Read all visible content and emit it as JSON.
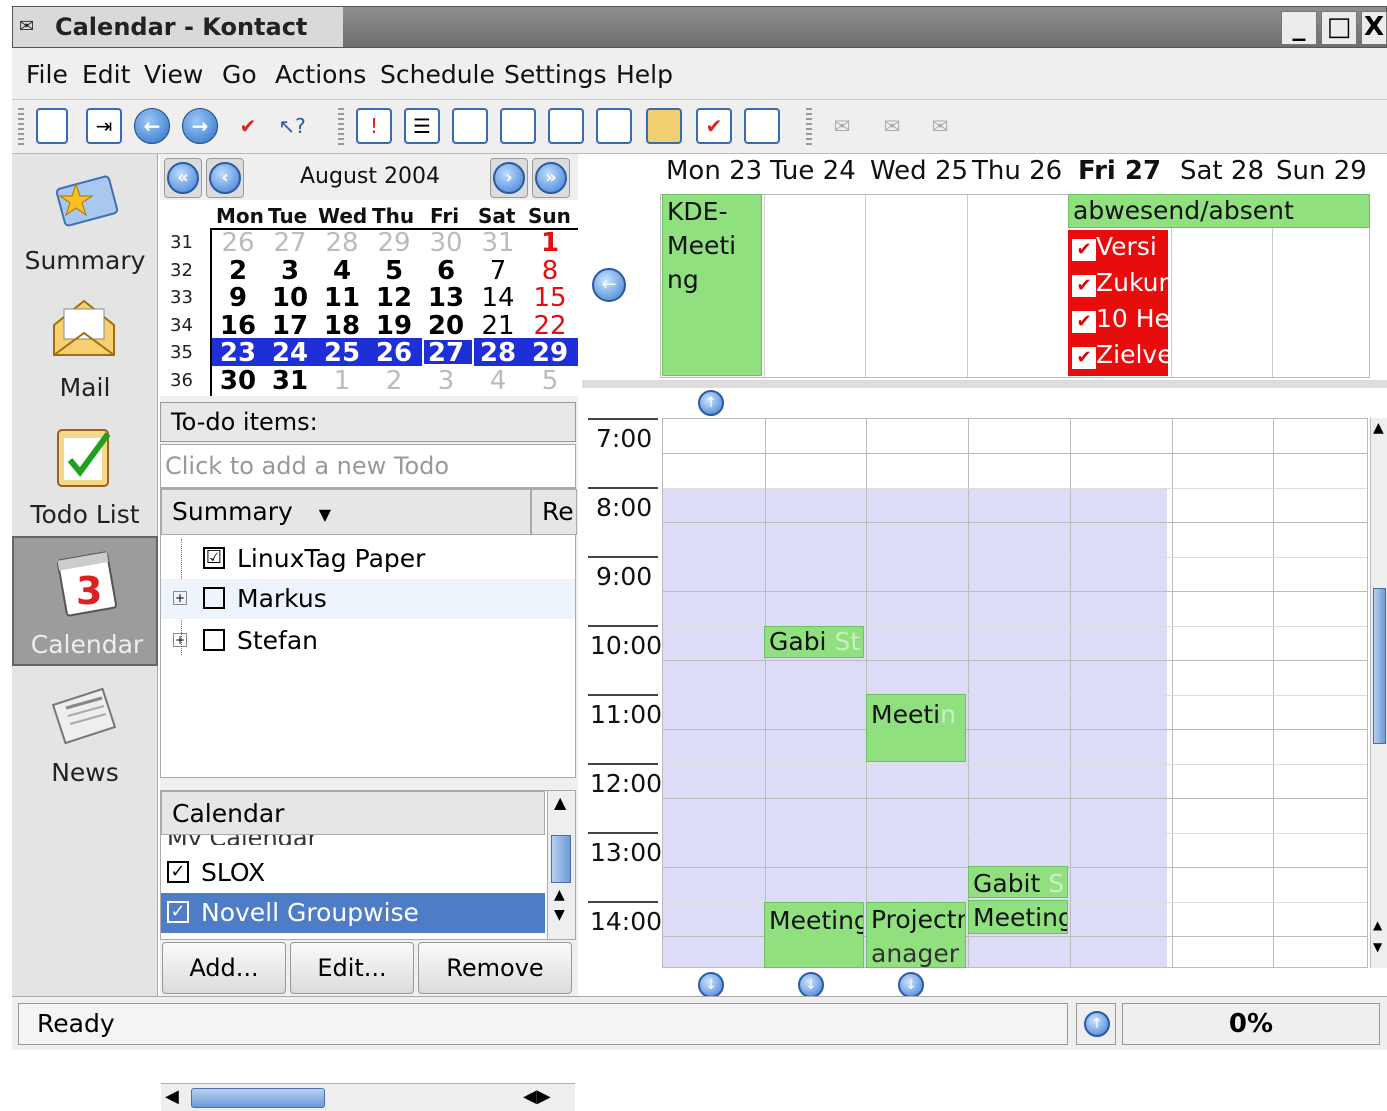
{
  "window": {
    "title": "Calendar - Kontact",
    "min": "_",
    "max": "□",
    "close": "X"
  },
  "menu": [
    "File",
    "Edit",
    "View",
    "Go",
    "Actions",
    "Schedule",
    "Settings",
    "Help"
  ],
  "sidebar": [
    {
      "label": "Summary",
      "icon": "summary-icon"
    },
    {
      "label": "Mail",
      "icon": "mail-icon"
    },
    {
      "label": "Todo List",
      "icon": "todo-icon"
    },
    {
      "label": "Calendar",
      "icon": "calendar-icon",
      "calendar_day": "3"
    },
    {
      "label": "News",
      "icon": "news-icon"
    }
  ],
  "datenav": {
    "month": "August 2004",
    "day_headers": [
      "Mon",
      "Tue",
      "Wed",
      "Thu",
      "Fri",
      "Sat",
      "Sun"
    ],
    "weeks": [
      {
        "no": "31",
        "days": [
          "26",
          "27",
          "28",
          "29",
          "30",
          "31",
          "1"
        ]
      },
      {
        "no": "32",
        "days": [
          "2",
          "3",
          "4",
          "5",
          "6",
          "7",
          "8"
        ]
      },
      {
        "no": "33",
        "days": [
          "9",
          "10",
          "11",
          "12",
          "13",
          "14",
          "15"
        ]
      },
      {
        "no": "34",
        "days": [
          "16",
          "17",
          "18",
          "19",
          "20",
          "21",
          "22"
        ]
      },
      {
        "no": "35",
        "days": [
          "23",
          "24",
          "25",
          "26",
          "27",
          "28",
          "29"
        ]
      },
      {
        "no": "36",
        "days": [
          "30",
          "31",
          "1",
          "2",
          "3",
          "4",
          "5"
        ]
      }
    ]
  },
  "todo": {
    "header": "To-do items:",
    "placeholder": "Click to add a new Todo",
    "columns": [
      "Summary",
      "Re"
    ],
    "items": [
      {
        "label": "LinuxTag Paper",
        "checked": "☑"
      },
      {
        "label": "Markus",
        "checked": ""
      },
      {
        "label": "Stefan",
        "checked": ""
      }
    ]
  },
  "calendars": {
    "header": "Calendar",
    "hidden_item": "My Calendar",
    "items": [
      "SLOX",
      "Novell Groupwise"
    ],
    "buttons": [
      "Add...",
      "Edit...",
      "Remove"
    ]
  },
  "week": {
    "days": [
      "Mon 23",
      "Tue 24",
      "Wed 25",
      "Thu 26",
      "Fri 27",
      "Sat 28",
      "Sun 29"
    ],
    "allday": {
      "mon": [
        "KDE-",
        "Meeti",
        "ng"
      ],
      "absent": "abwesend/absent",
      "fri_todos": [
        "Versi",
        "Zukur",
        "10 He",
        "Zielve"
      ]
    },
    "times": [
      "7:00",
      "8:00",
      "9:00",
      "10:00",
      "11:00",
      "12:00",
      "13:00",
      "14:00"
    ],
    "events": [
      {
        "text": "Gabi ",
        "fade": "St"
      },
      {
        "text": "Meeti",
        "fade": "n"
      },
      {
        "text": "Gabit ",
        "fade": "S"
      },
      {
        "text": "Meeting",
        "fade": ""
      },
      {
        "text": "Projectn",
        "fade": ""
      },
      {
        "text": "anager",
        "fade": ""
      },
      {
        "text": "Meeting",
        "fade": ""
      }
    ]
  },
  "status": {
    "text": "Ready",
    "progress": "0%"
  }
}
